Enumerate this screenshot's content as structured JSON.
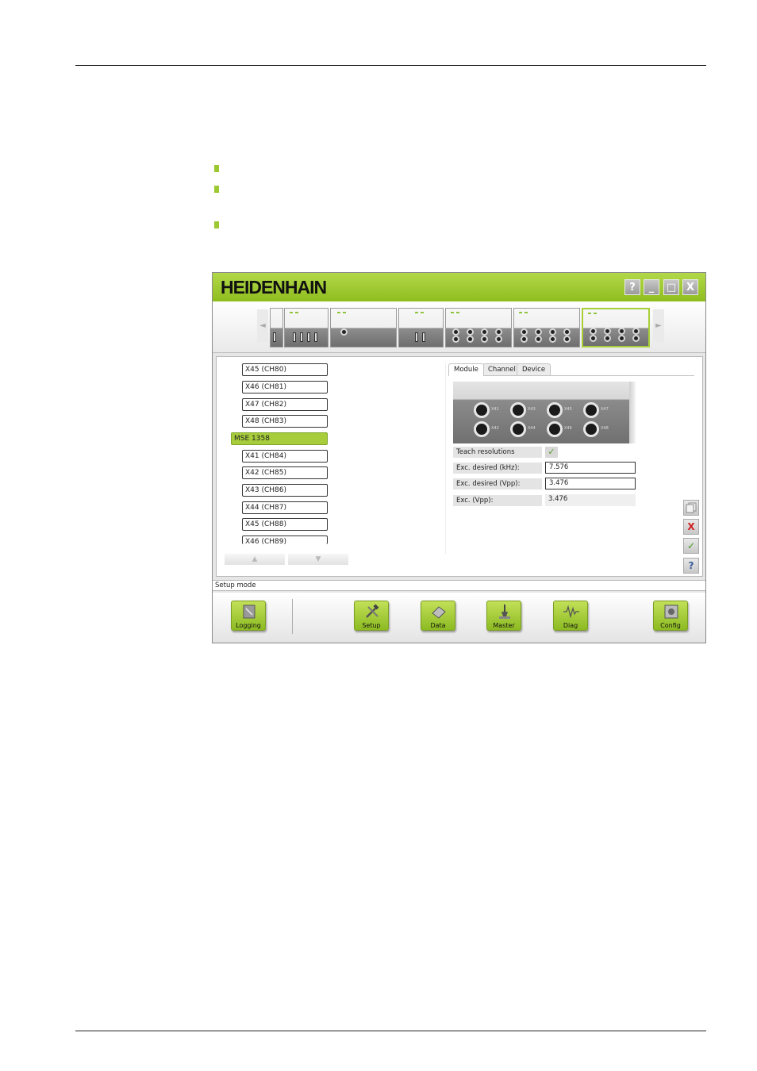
{
  "app": {
    "brand": "HEIDENHAIN",
    "window_buttons": [
      "?",
      "_",
      "□",
      "X"
    ],
    "strip": {
      "left_arrow": "◄",
      "right_arrow": "►"
    },
    "list_items": [
      {
        "label": "X45 (CH80)",
        "header": false
      },
      {
        "label": "X46 (CH81)",
        "header": false
      },
      {
        "label": "X47 (CH82)",
        "header": false
      },
      {
        "label": "X48 (CH83)",
        "header": false
      },
      {
        "label": "MSE 1358",
        "header": true
      },
      {
        "label": "X41 (CH84)",
        "header": false
      },
      {
        "label": "X42 (CH85)",
        "header": false
      },
      {
        "label": "X43 (CH86)",
        "header": false
      },
      {
        "label": "X44 (CH87)",
        "header": false
      },
      {
        "label": "X45 (CH88)",
        "header": false
      },
      {
        "label": "X46 (CH89)",
        "header": false
      }
    ],
    "list_scroll": {
      "up": "▲",
      "down": "▼"
    },
    "tabs": [
      {
        "label": "Module",
        "active": true
      },
      {
        "label": "Channel",
        "active": false
      },
      {
        "label": "Device",
        "active": false
      }
    ],
    "module_ports": [
      "X41",
      "X43",
      "X45",
      "X47",
      "X42",
      "X44",
      "X46",
      "X48"
    ],
    "properties": {
      "teach": {
        "label": "Teach resolutions",
        "checked": true,
        "check_glyph": "✓"
      },
      "exc_khz": {
        "label": "Exc. desired (kHz):",
        "value": "7.576"
      },
      "exc_vpp_desired": {
        "label": "Exc. desired (Vpp):",
        "value": "3.476"
      },
      "exc_vpp": {
        "label": "Exc. (Vpp):",
        "value": "3.476"
      }
    },
    "side_buttons": {
      "cancel": "X",
      "accept": "✓",
      "help": "?"
    },
    "status_text": "Setup mode",
    "toolbar": {
      "logging": "Logging",
      "setup": "Setup",
      "data": "Data",
      "master": "Master",
      "diag": "Diag",
      "config": "Config"
    },
    "colors": {
      "accent": "#9cc832",
      "selected": "#a7cd3c"
    }
  }
}
